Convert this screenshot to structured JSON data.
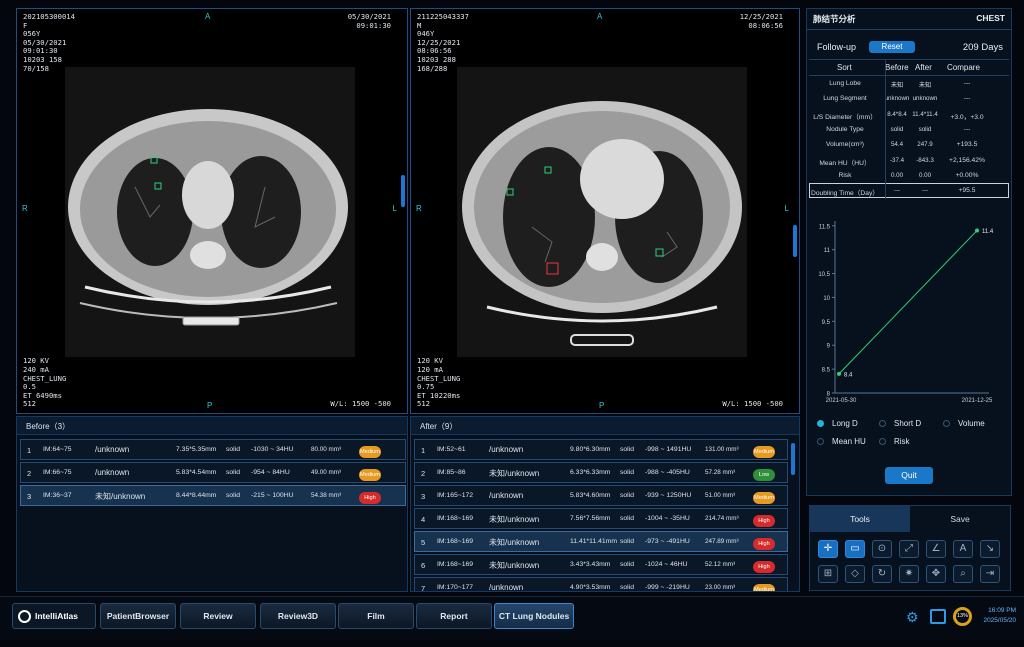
{
  "viewer_left": {
    "info_tl": "202105300014\nF\n056Y\n05/30/2021\n09:01:30\n10203 158\n70/158",
    "info_tr": "05/30/2021\n09:01:30",
    "info_bl": "120 KV\n240 mA\nCHEST_LUNG\n0.5\nET 6490ms\n512",
    "wl": "W/L: 1500 -500",
    "ori_top": "A",
    "ori_bottom": "P",
    "ori_left": "R",
    "ori_right": "L"
  },
  "viewer_right": {
    "info_tl": "211225043337\nM\n046Y\n12/25/2021\n08:06:56\n10203 288\n168/288",
    "info_tr": "12/25/2021\n08:06:56",
    "info_bl": "120 KV\n120 mA\nCHEST_LUNG\n0.75\nET 10220ms\n512",
    "wl": "W/L: 1500 -500",
    "ori_top": "A",
    "ori_bottom": "P",
    "ori_left": "R",
    "ori_right": "L"
  },
  "before": {
    "title": "Before（3）",
    "rows": [
      {
        "no": "1",
        "im": "IM:64~75",
        "seg": "/unknown",
        "dia": "7.35*5.35mm",
        "type": "solid",
        "hu": "-1030 ~ 34HU",
        "vol": "80.00 mm³",
        "risk": "Medium"
      },
      {
        "no": "2",
        "im": "IM:66~75",
        "seg": "/unknown",
        "dia": "5.83*4.54mm",
        "type": "solid",
        "hu": "-954 ~ 84HU",
        "vol": "49.00 mm³",
        "risk": "Medium"
      },
      {
        "no": "3",
        "im": "IM:36~37",
        "seg": "未知/unknown",
        "dia": "8.44*8.44mm",
        "type": "solid",
        "hu": "-215 ~ 100HU",
        "vol": "54.38 mm³",
        "risk": "High"
      }
    ]
  },
  "after": {
    "title": "After（9）",
    "rows": [
      {
        "no": "1",
        "im": "IM:52~61",
        "seg": "/unknown",
        "dia": "9.80*6.30mm",
        "type": "solid",
        "hu": "-998 ~ 1491HU",
        "vol": "131.00 mm³",
        "risk": "Medium"
      },
      {
        "no": "2",
        "im": "IM:85~86",
        "seg": "未知/unknown",
        "dia": "6.33*6.33mm",
        "type": "solid",
        "hu": "-988 ~ -405HU",
        "vol": "57.28 mm³",
        "risk": "Low"
      },
      {
        "no": "3",
        "im": "IM:165~172",
        "seg": "/unknown",
        "dia": "5.83*4.60mm",
        "type": "solid",
        "hu": "-939 ~ 1250HU",
        "vol": "51.00 mm³",
        "risk": "Medium"
      },
      {
        "no": "4",
        "im": "IM:168~169",
        "seg": "未知/unknown",
        "dia": "7.56*7.56mm",
        "type": "solid",
        "hu": "-1004 ~ -35HU",
        "vol": "214.74 mm³",
        "risk": "High"
      },
      {
        "no": "5",
        "im": "IM:168~169",
        "seg": "未知/unknown",
        "dia": "11.41*11.41mm",
        "type": "solid",
        "hu": "-973 ~ -491HU",
        "vol": "247.89 mm³",
        "risk": "High"
      },
      {
        "no": "6",
        "im": "IM:168~169",
        "seg": "未知/unknown",
        "dia": "3.43*3.43mm",
        "type": "solid",
        "hu": "-1024 ~ 46HU",
        "vol": "52.12 mm³",
        "risk": "High"
      },
      {
        "no": "7",
        "im": "IM:170~177",
        "seg": "/unknown",
        "dia": "4.90*3.53mm",
        "type": "solid",
        "hu": "-999 ~ -219HU",
        "vol": "23.00 mm³",
        "risk": "Medium"
      }
    ]
  },
  "panel": {
    "title": "肺结节分析",
    "body": "CHEST",
    "followup_label": "Follow-up",
    "reset_label": "Reset",
    "days": "209 Days",
    "headers": [
      "Sort",
      "Before",
      "After",
      "Compare"
    ],
    "rows": [
      {
        "label": "Lung Lobe",
        "before": "未知",
        "after": "未知",
        "compare": "---"
      },
      {
        "label": "Lung Segment",
        "before": "unknown",
        "after": "unknown",
        "compare": "---"
      },
      {
        "label": "L/S Diameter（mm）",
        "before": "8.4*8.4",
        "after": "11.4*11.4",
        "compare": "+3.0，+3.0"
      },
      {
        "label": "Nodule Type",
        "before": "solid",
        "after": "solid",
        "compare": "---"
      },
      {
        "label": "Volume(cm³)",
        "before": "54.4",
        "after": "247.9",
        "compare": "+193.5"
      },
      {
        "label": "Mean HU（HU）",
        "before": "-37.4",
        "after": "-843.3",
        "compare": "+2,156.42%"
      },
      {
        "label": "Risk",
        "before": "0.00",
        "after": "0.00",
        "compare": "+0.00%"
      },
      {
        "label": "Doubling Time（Day）",
        "before": "---",
        "after": "---",
        "compare": "+95.5"
      }
    ],
    "radios": [
      {
        "label": "Long D",
        "on": true
      },
      {
        "label": "Short D",
        "on": false
      },
      {
        "label": "Volume",
        "on": false
      },
      {
        "label": "Mean HU",
        "on": false
      },
      {
        "label": "Risk",
        "on": false
      }
    ],
    "quit_label": "Quit"
  },
  "chart_data": {
    "type": "line",
    "x": [
      "2021-05-30",
      "2021-12-25"
    ],
    "y": [
      8.4,
      11.4
    ],
    "point_labels": [
      "8.4",
      "11.4"
    ],
    "yticks": [
      "8",
      "8.5",
      "9",
      "9.5",
      "10",
      "10.5",
      "11",
      "11.5"
    ],
    "ylim": [
      8,
      11.6
    ],
    "color": "#2fd07a"
  },
  "tools": {
    "tab_tools": "Tools",
    "tab_save": "Save",
    "icons": [
      "crosshair-icon",
      "comment-icon",
      "circle-target-icon",
      "line-measure-icon",
      "angle-icon",
      "text-annotation-icon",
      "arrow-icon",
      "grid-icon",
      "eraser-icon",
      "rotate-icon",
      "settings-sparkle-icon",
      "move-icon",
      "zoom-icon",
      "exit-icon"
    ]
  },
  "taskbar": {
    "logo": "IntelliAtlas",
    "tabs": [
      "PatientBrowser",
      "Review",
      "Review3D",
      "Film",
      "Report",
      "CT Lung Nodules"
    ],
    "active": "CT Lung Nodules",
    "progress": "13%",
    "time": "16:09 PM",
    "date": "2025/05/20"
  }
}
